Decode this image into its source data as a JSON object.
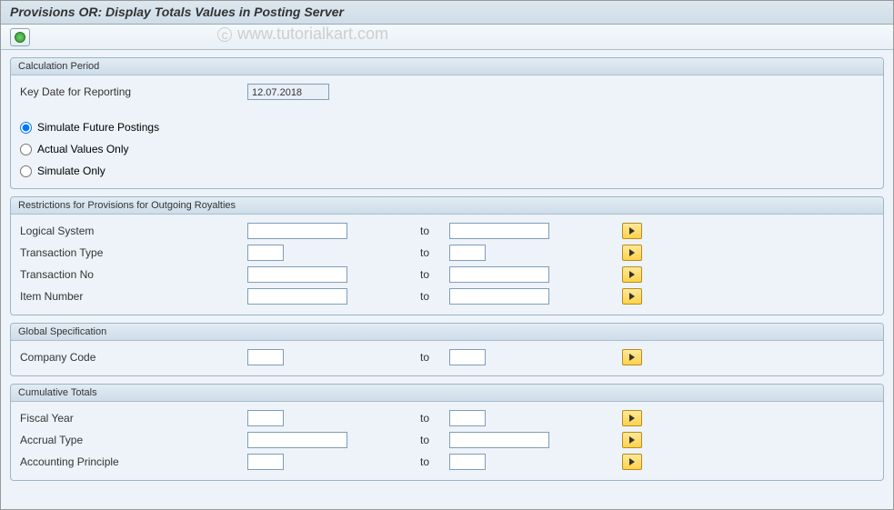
{
  "title": "Provisions OR: Display Totals Values in Posting Server",
  "watermark": "www.tutorialkart.com",
  "groups": {
    "calc_period": {
      "title": "Calculation Period",
      "key_date_label": "Key Date for Reporting",
      "key_date_value": "12.07.2018",
      "radios": {
        "simulate_future": "Simulate Future Postings",
        "actual_values": "Actual Values Only",
        "simulate_only": "Simulate Only"
      },
      "selected": "simulate_future"
    },
    "restrictions": {
      "title": "Restrictions for Provisions for Outgoing Royalties",
      "to_label": "to",
      "rows": [
        {
          "name": "logical-system",
          "label": "Logical System",
          "from_w": 110,
          "to_w": 110,
          "from": "",
          "to": ""
        },
        {
          "name": "transaction-type",
          "label": "Transaction Type",
          "from_w": 40,
          "to_w": 40,
          "from": "",
          "to": ""
        },
        {
          "name": "transaction-no",
          "label": "Transaction No",
          "from_w": 110,
          "to_w": 110,
          "from": "",
          "to": ""
        },
        {
          "name": "item-number",
          "label": "Item Number",
          "from_w": 110,
          "to_w": 110,
          "from": "",
          "to": ""
        }
      ]
    },
    "global_spec": {
      "title": "Global Specification",
      "to_label": "to",
      "rows": [
        {
          "name": "company-code",
          "label": "Company Code",
          "from_w": 40,
          "to_w": 40,
          "from": "",
          "to": ""
        }
      ]
    },
    "cumulative": {
      "title": "Cumulative Totals",
      "to_label": "to",
      "rows": [
        {
          "name": "fiscal-year",
          "label": "Fiscal Year",
          "from_w": 40,
          "to_w": 40,
          "from": "",
          "to": ""
        },
        {
          "name": "accrual-type",
          "label": "Accrual Type",
          "from_w": 110,
          "to_w": 110,
          "from": "",
          "to": ""
        },
        {
          "name": "accounting-principle",
          "label": "Accounting Principle",
          "from_w": 40,
          "to_w": 40,
          "from": "",
          "to": ""
        }
      ]
    }
  }
}
